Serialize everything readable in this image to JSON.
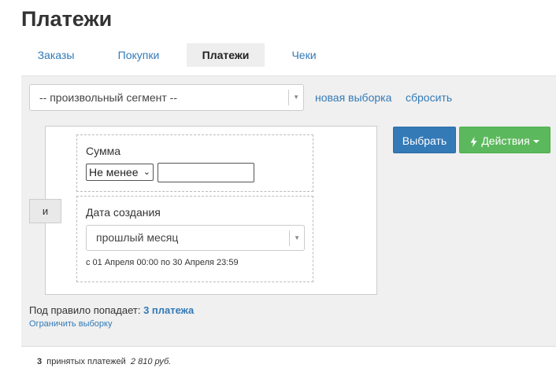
{
  "page": {
    "title": "Платежи"
  },
  "tabs": [
    {
      "label": "Заказы",
      "active": false
    },
    {
      "label": "Покупки",
      "active": false
    },
    {
      "label": "Платежи",
      "active": true
    },
    {
      "label": "Чеки",
      "active": false
    }
  ],
  "segment": {
    "selected": "-- произвольный сегмент --",
    "new_selection_link": "новая выборка",
    "reset_link": "сбросить"
  },
  "rules": {
    "connector_label": "и",
    "sum_rule": {
      "label": "Сумма",
      "operator": "Не менее",
      "value": ""
    },
    "date_rule": {
      "label": "Дата создания",
      "selected": "прошлый месяц",
      "range_text": "с 01 Апреля 00:00 по 30 Апреля 23:59"
    }
  },
  "actions": {
    "select_label": "Выбрать",
    "actions_label": "Действия"
  },
  "result": {
    "prefix": "Под правило попадает:",
    "count_text": "3 платежа",
    "limit_link": "Ограничить выборку"
  },
  "footer": {
    "count": "3",
    "text": "принятых платежей",
    "sum": "2 810 руб."
  },
  "colors": {
    "link": "#337ab7",
    "primary": "#337ab7",
    "success": "#5cb85c",
    "panel_bg": "#f0f0f0"
  }
}
